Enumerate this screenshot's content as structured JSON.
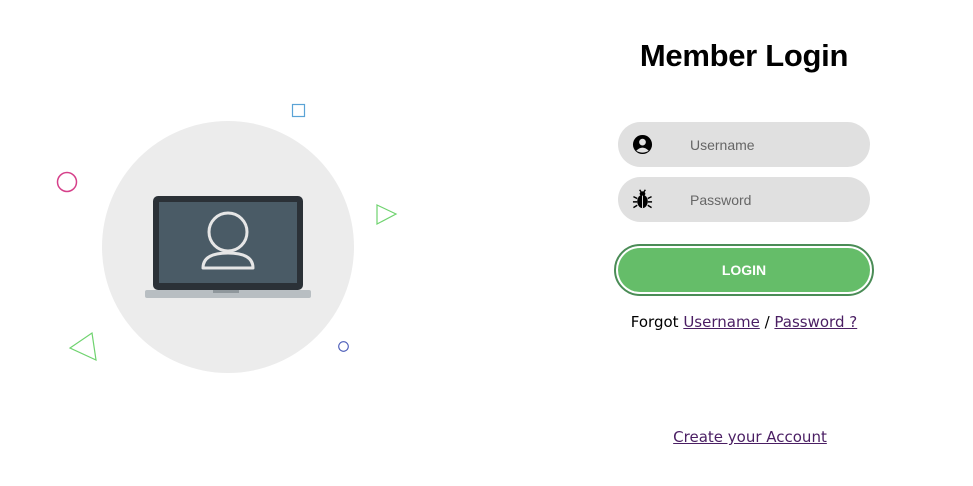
{
  "login": {
    "title": "Member Login",
    "username_placeholder": "Username",
    "password_placeholder": "Password",
    "login_label": "LOGIN",
    "forgot_prefix": "Forgot",
    "forgot_username": "Username",
    "forgot_separator": "/",
    "forgot_password": "Password ?",
    "create_account": "Create your Account"
  },
  "icons": {
    "username_icon": "user-circle-icon",
    "password_icon": "bug-icon",
    "illustration": "laptop-user-icon"
  },
  "colors": {
    "accent_green": "#65bd69",
    "button_border": "#4a8c56",
    "field_bg": "#e0e0e0",
    "link": "#4a1e63",
    "illustration_bg": "#ececec"
  }
}
